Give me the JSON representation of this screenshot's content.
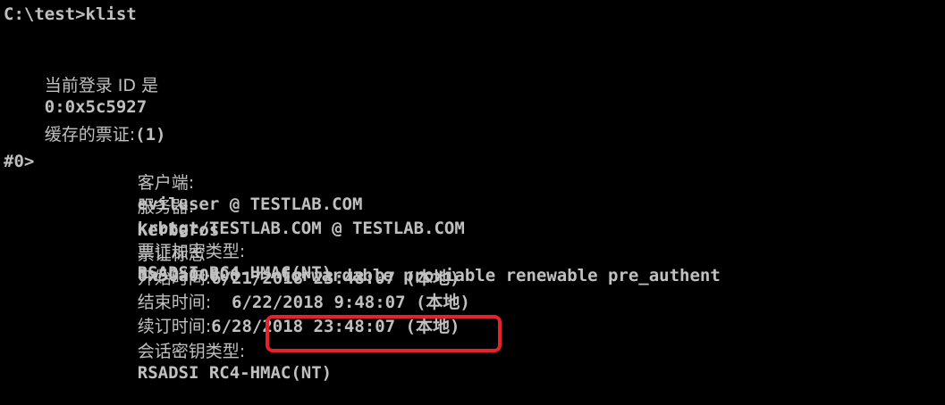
{
  "console": {
    "command_line": "C:\\test>klist",
    "logon_id_label": "当前登录 ID 是",
    "logon_id_value": "0:0x5c5927",
    "cached_tickets_label": "缓存的票证:",
    "cached_tickets_count": "(1)",
    "ticket": {
      "index": "#0>",
      "client_label": "客户端:",
      "client_value": "eviluser @ TESTLAB.COM",
      "server_label": "服务器:",
      "server_value": "krbtgt/TESTLAB.COM @ TESTLAB.COM",
      "enc_type_prefix": "Kerberos",
      "enc_type_label": "票证加密类型:",
      "enc_type_value": "RSADSI RC4-HMAC(NT)",
      "flags_label": "票证标志",
      "flags_value": "0x50a00000 -> forwardable proxiable renewable pre_authent",
      "start_time_label": "开始时间:",
      "start_time_value": "6/21/2018 23:48:07 (本地)",
      "end_time_label": "结束时间:",
      "end_time_value": "  6/22/2018 9:48:07 (本地)",
      "renew_time_label": "续订时间:",
      "renew_time_value": "6/28/2018 23:48:07 (本地)",
      "session_key_label": "会话密钥类型:",
      "session_key_value": "RSADSI RC4-HMAC(NT)"
    }
  },
  "colors": {
    "background": "#000000",
    "text": "#c0c0c0",
    "highlight_border": "#e3232b"
  }
}
